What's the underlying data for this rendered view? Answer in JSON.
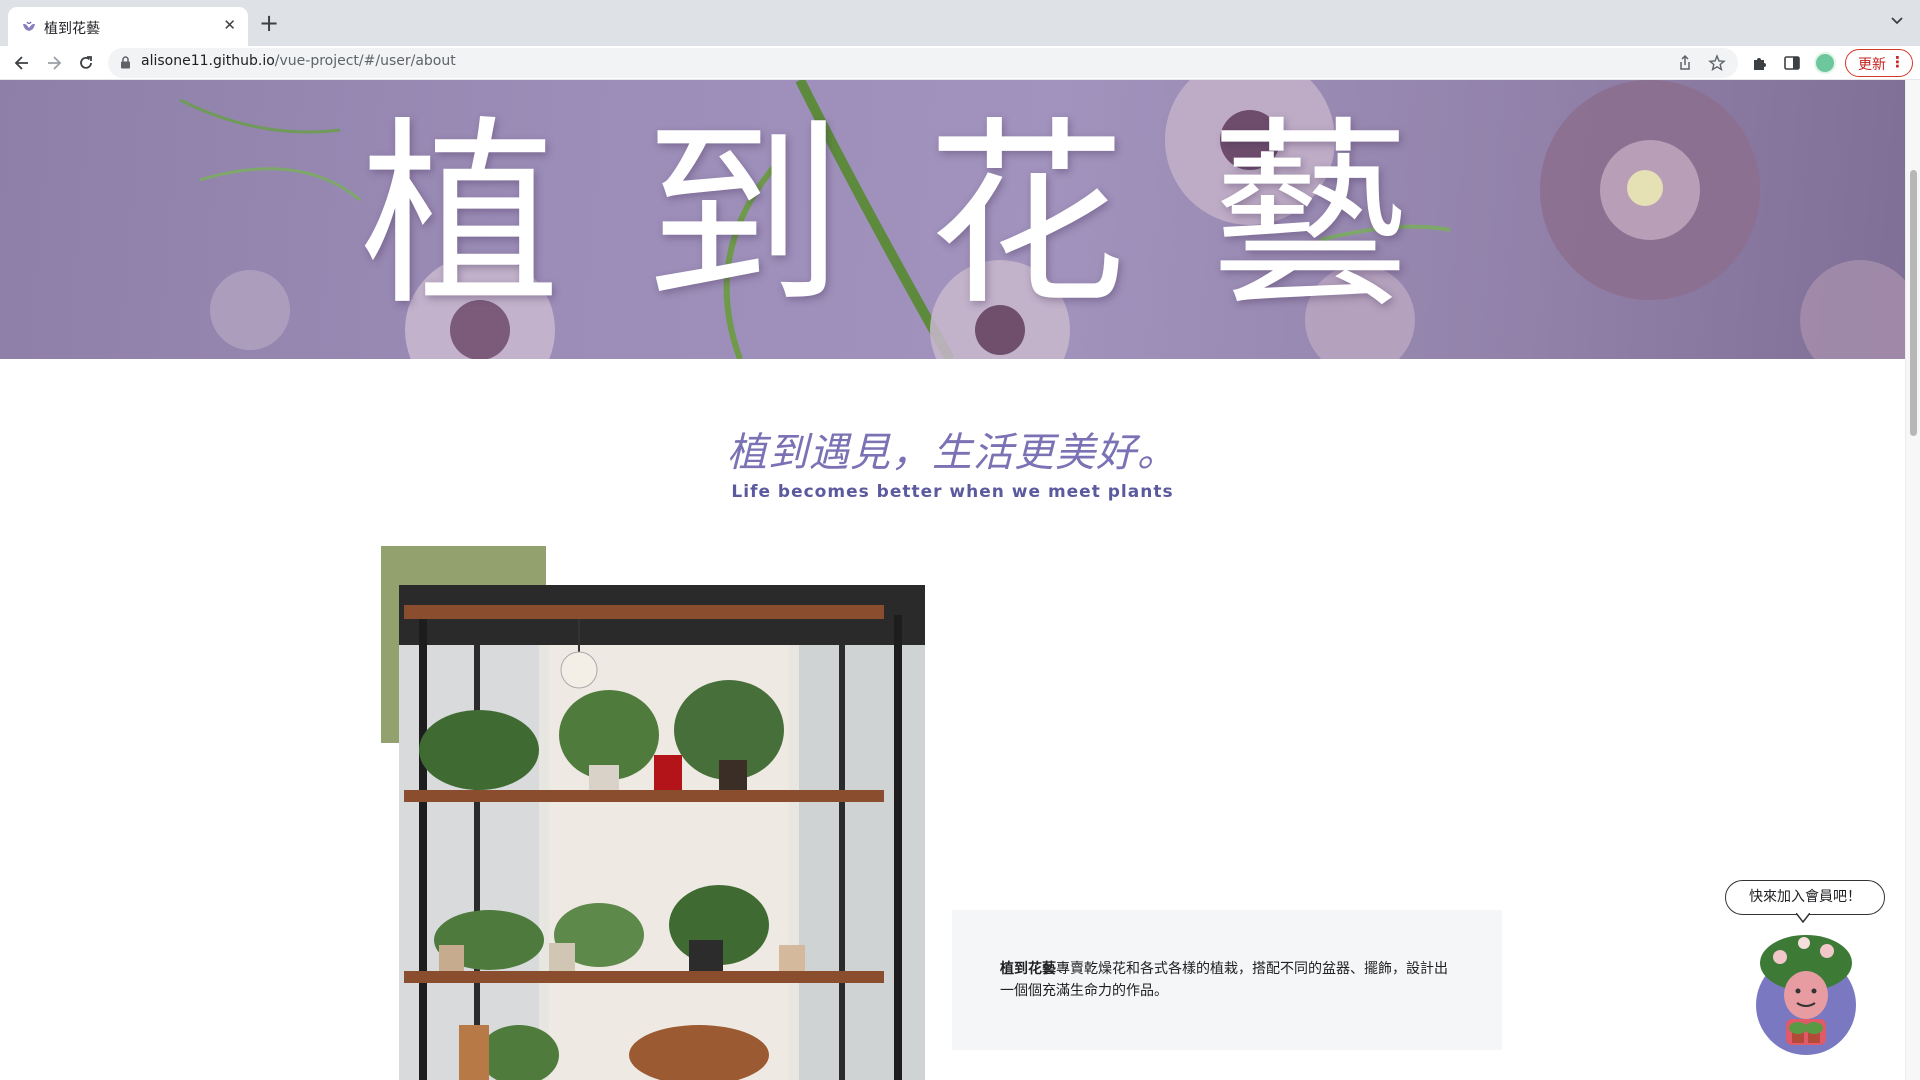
{
  "browser": {
    "tab_title": "植到花藝",
    "url_host": "alisone11.github.io",
    "url_path": "/vue-project/#/user/about",
    "update_label": "更新"
  },
  "hero": {
    "title_chars": [
      "植",
      "到",
      "花",
      "藝"
    ]
  },
  "slogan": {
    "zh": "植到遇見，生活更美好。",
    "en": "Life becomes better when we meet plants"
  },
  "intro": {
    "brand": "植到花藝",
    "text": "專賣乾燥花和各式各樣的植栽，搭配不同的盆器、擺飾，設計出一個個充滿生命力的作品。"
  },
  "member_bubble": "快來加入會員吧！",
  "colors": {
    "hero_purple": "#9c8db8",
    "slogan_purple": "#7a72b4",
    "accent_green": "#93a16f",
    "update_red": "#c5221f"
  }
}
